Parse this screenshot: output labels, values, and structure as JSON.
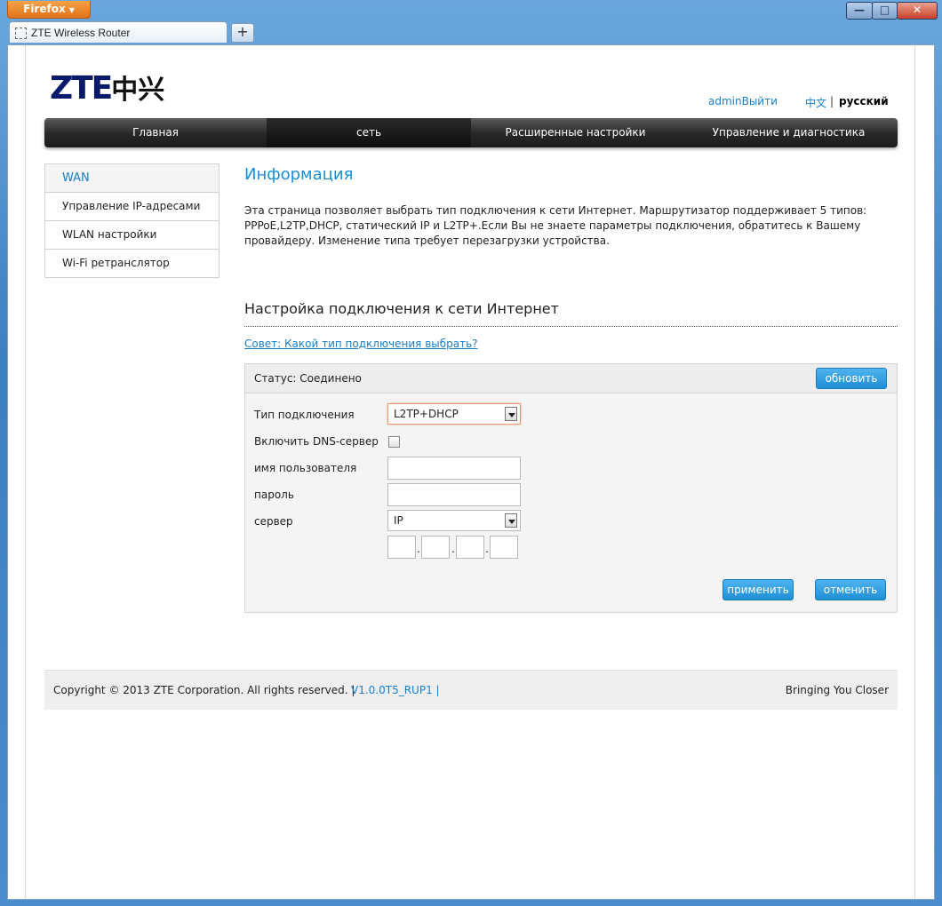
{
  "browser": {
    "app_button": "Firefox",
    "tab_title": "ZTE Wireless Router",
    "new_tab": "+",
    "window_controls": {
      "minimize": "—",
      "maximize": "□",
      "close": "✕"
    }
  },
  "header": {
    "logo_latin": "ZTE",
    "logo_chinese": "中兴",
    "admin_link": "adminВыйти",
    "lang_cn": "中文",
    "lang_sep": "|",
    "lang_ru": "русский"
  },
  "nav": {
    "items": [
      {
        "label": "Главная"
      },
      {
        "label": "сеть",
        "active": true
      },
      {
        "label": "Расширенные настройки"
      },
      {
        "label": "Управление и диагностика"
      }
    ]
  },
  "sidebar": {
    "items": [
      {
        "label": "WAN",
        "active": true
      },
      {
        "label": "Управление IP-адресами"
      },
      {
        "label": "WLAN настройки"
      },
      {
        "label": "Wi-Fi ретранслятор"
      }
    ]
  },
  "main": {
    "title": "Информация",
    "description": "Эта страница позволяет выбрать тип подключения к сети Интернет. Маршрутизатор поддерживает 5 типов: PPPoE,L2TP,DHCP, статический IP и L2TP+.Если Вы не знаете параметры подключения, обратитесь к Вашему провайдеру. Изменение типа требует перезагрузки устройства.",
    "section_title": "Настройка подключения к сети Интернет",
    "tip_link": "Совет: Какой тип подключения выбрать?",
    "panel": {
      "status": "Статус: Соединено",
      "refresh_button": "обновить",
      "connection_type_label": "Тип подключения",
      "connection_type_value": "L2TP+DHCP",
      "dns_label": "Включить DNS-сервер",
      "dns_checked": false,
      "username_label": "имя пользователя",
      "username_value": "",
      "password_label": "пароль",
      "password_value": "",
      "server_label": "сервер",
      "server_type_value": "IP",
      "ip_octets": [
        "",
        "",
        "",
        ""
      ],
      "ip_sep": ".",
      "apply_button": "применить",
      "cancel_button": "отменить"
    }
  },
  "footer": {
    "copyright": "Copyright © 2013 ZTE Corporation. All rights reserved.  |",
    "version": "V1.0.0T5_RUP1  |",
    "slogan": "Bringing You Closer"
  }
}
